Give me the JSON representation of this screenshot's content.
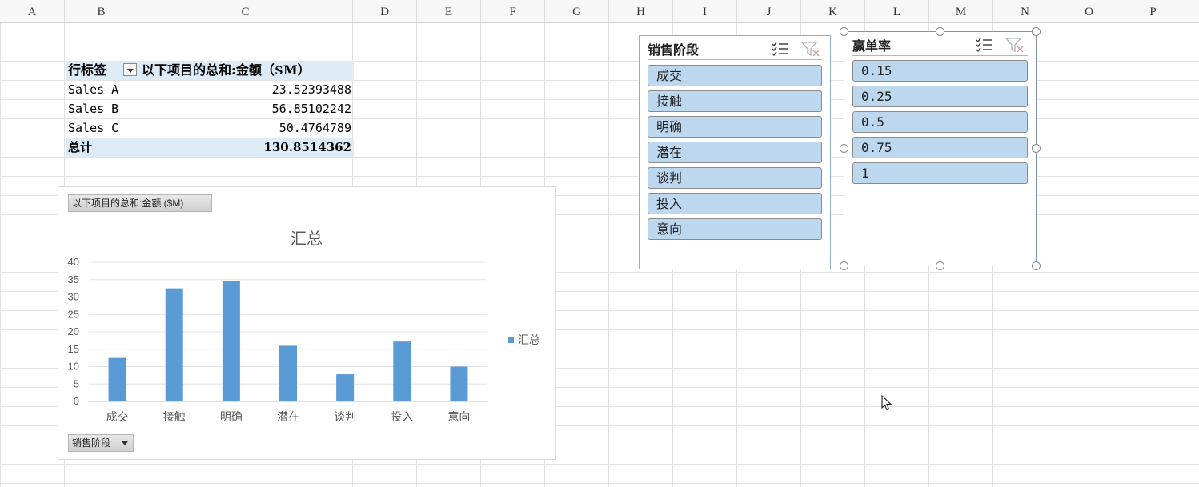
{
  "columns": [
    "A",
    "B",
    "C",
    "D",
    "E",
    "F",
    "G",
    "H",
    "I",
    "J",
    "K",
    "L",
    "M",
    "N",
    "O",
    "P"
  ],
  "pivot": {
    "row_labels_header": "行标签",
    "value_header": "以下项目的总和:金额（$M）",
    "rows": [
      {
        "label": "Sales A",
        "value": "23.52393488"
      },
      {
        "label": "Sales B",
        "value": "56.85102242"
      },
      {
        "label": "Sales C",
        "value": "50.4764789"
      }
    ],
    "total_label": "总计",
    "total_value": "130.8514362"
  },
  "chart": {
    "value_field_button": "以下项目的总和:金额 ($M)",
    "axis_field_button": "销售阶段",
    "series_color": "#5b9bd5"
  },
  "chart_data": {
    "type": "bar",
    "title": "汇总",
    "categories": [
      "成交",
      "接触",
      "明确",
      "潜在",
      "谈判",
      "投入",
      "意向"
    ],
    "series": [
      {
        "name": "汇总",
        "values": [
          12.5,
          32.5,
          34.5,
          16,
          7.8,
          17.2,
          10
        ]
      }
    ],
    "ylim": [
      0,
      40
    ],
    "yticks": [
      0,
      5,
      10,
      15,
      20,
      25,
      30,
      35,
      40
    ],
    "grid": true,
    "legend": "right"
  },
  "slicer_stage": {
    "title": "销售阶段",
    "items": [
      "成交",
      "接触",
      "明确",
      "潜在",
      "谈判",
      "投入",
      "意向"
    ]
  },
  "slicer_rate": {
    "title": "赢单率",
    "items": [
      "0.15",
      "0.25",
      "0.5",
      "0.75",
      "1"
    ]
  },
  "icons": {
    "multiselect": "multiselect-icon",
    "clear_filter": "clear-filter-icon",
    "cursor": "mouse-pointer-icon"
  }
}
